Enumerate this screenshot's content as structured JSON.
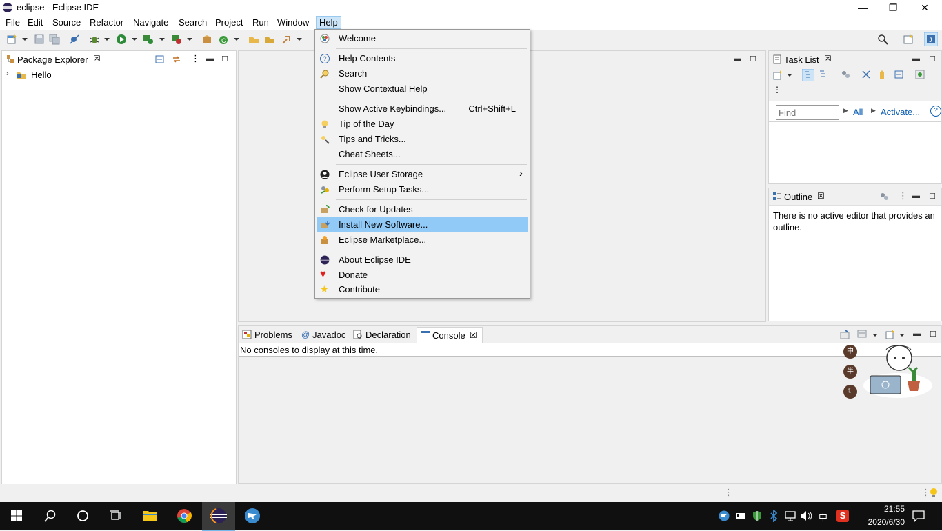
{
  "window": {
    "title": "eclipse - Eclipse IDE",
    "minimize": "—",
    "restore": "❐",
    "close": "✕"
  },
  "menubar": [
    "File",
    "Edit",
    "Source",
    "Refactor",
    "Navigate",
    "Search",
    "Project",
    "Run",
    "Window",
    "Help"
  ],
  "package_explorer": {
    "tab": "Package Explorer",
    "items": [
      {
        "label": "Hello"
      }
    ]
  },
  "task_list": {
    "tab": "Task List",
    "find_placeholder": "Find",
    "all_link": "All",
    "activate_link": "Activate..."
  },
  "outline": {
    "tab": "Outline",
    "message": "There is no active editor that provides an outline."
  },
  "bottom_panel": {
    "tabs": [
      "Problems",
      "Javadoc",
      "Declaration",
      "Console"
    ],
    "message": "No consoles to display at this time."
  },
  "help_menu": {
    "items": [
      {
        "label": "Welcome",
        "icon": "welcome-icon"
      },
      {
        "label": "Help Contents",
        "icon": "help-icon"
      },
      {
        "label": "Search",
        "icon": "search-help-icon"
      },
      {
        "label": "Show Contextual Help",
        "icon": ""
      },
      {
        "label": "Show Active Keybindings...",
        "shortcut": "Ctrl+Shift+L"
      },
      {
        "label": "Tip of the Day",
        "icon": "lightbulb-icon"
      },
      {
        "label": "Tips and Tricks...",
        "icon": "tips-icon"
      },
      {
        "label": "Cheat Sheets...",
        "icon": ""
      },
      {
        "label": "Eclipse User Storage",
        "icon": "user-icon",
        "submenu": "›"
      },
      {
        "label": "Perform Setup Tasks...",
        "icon": "setup-icon"
      },
      {
        "label": "Check for Updates",
        "icon": "update-icon"
      },
      {
        "label": "Install New Software...",
        "icon": "install-icon"
      },
      {
        "label": "Eclipse Marketplace...",
        "icon": "marketplace-icon"
      },
      {
        "label": "About Eclipse IDE",
        "icon": "eclipse-icon"
      },
      {
        "label": "Donate",
        "icon": "heart-icon"
      },
      {
        "label": "Contribute",
        "icon": "star-icon"
      }
    ]
  },
  "taskbar": {
    "time": "21:55",
    "date": "2020/6/30",
    "ime": "中"
  },
  "widget": {
    "buttons": [
      "中",
      "半",
      "☾"
    ]
  },
  "colors": {
    "highlight": "#91c9f7",
    "link": "#0b5db3",
    "heart": "#e02020",
    "star": "#f5c518"
  }
}
